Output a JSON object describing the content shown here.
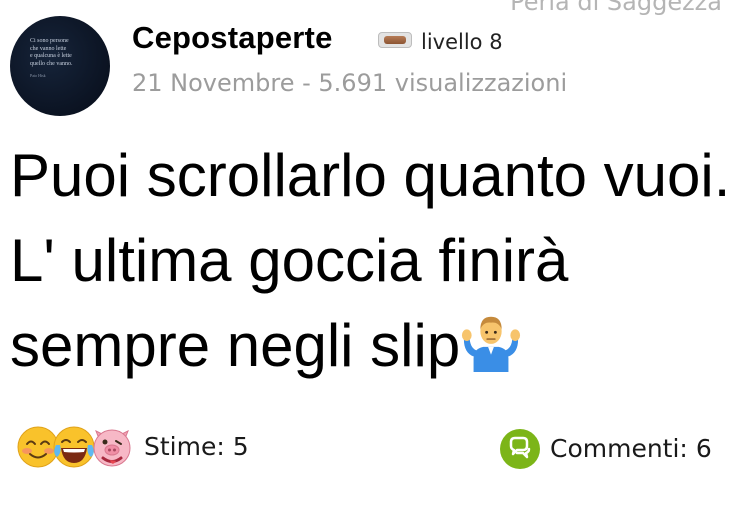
{
  "header": {
    "category": "Perla di Saggezza",
    "username": "Cepostaperte",
    "level": "livello 8",
    "meta": "21 Novembre - 5.691 visualizzazioni"
  },
  "avatar": {
    "lines": [
      "Ci sono persone",
      "che vanno lette",
      "e qualcuna è lette",
      "quello che vanno."
    ],
    "signature": "Paio Hisk"
  },
  "post": {
    "text": "Puoi scrollarlo quanto vuoi. L' ultima goccia finirà sempre negli slip",
    "emoji": "man-shrugging-icon"
  },
  "footer": {
    "reactions_icons": [
      "smiling-blush-face-icon",
      "laughing-tears-face-icon",
      "pig-face-icon"
    ],
    "stime_label": "Stime:",
    "stime_count": "5",
    "comments_label": "Commenti:",
    "comments_count": "6",
    "accent": "#7cb518"
  }
}
